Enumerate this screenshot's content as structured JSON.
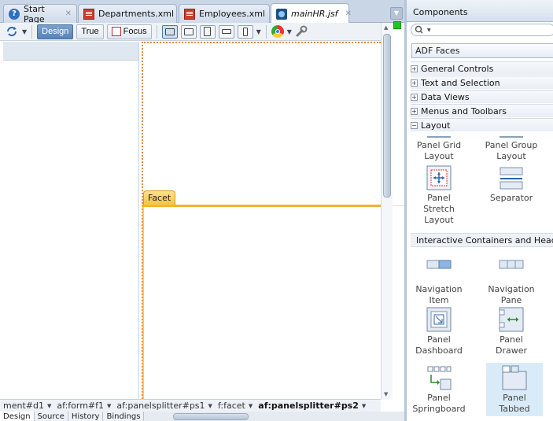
{
  "tabs": [
    {
      "label": "Start Page",
      "icon": "help-icon"
    },
    {
      "label": "Departments.xml",
      "icon": "xml-file-icon"
    },
    {
      "label": "Employees.xml",
      "icon": "xml-file-icon"
    },
    {
      "label": "mainHR.jsf",
      "icon": "jsf-file-icon",
      "active": true
    }
  ],
  "toolbar": {
    "design_label": "Design",
    "true_label": "True",
    "focus_label": "Focus"
  },
  "canvas": {
    "facet_label": "Facet"
  },
  "breadcrumb": [
    {
      "label": "ment#d1"
    },
    {
      "label": "af:form#f1"
    },
    {
      "label": "af:panelsplitter#ps1"
    },
    {
      "label": "f:facet"
    },
    {
      "label": "af:panelsplitter#ps2",
      "bold": true
    }
  ],
  "bottom_tabs": [
    "Design",
    "Source",
    "History",
    "Bindings"
  ],
  "palette": {
    "title": "Components",
    "search_placeholder": "",
    "library": "ADF Faces",
    "sections": [
      {
        "label": "General Controls",
        "expanded": false
      },
      {
        "label": "Text and Selection",
        "expanded": false
      },
      {
        "label": "Data Views",
        "expanded": false
      },
      {
        "label": "Menus and Toolbars",
        "expanded": false
      },
      {
        "label": "Layout",
        "expanded": true
      }
    ],
    "layout_items": [
      {
        "label": "Panel Grid Layout"
      },
      {
        "label": "Panel Group Layout"
      },
      {
        "label": "Panel Stretch Layout"
      },
      {
        "label": "Separator"
      }
    ],
    "interactive_header": "Interactive Containers and Headers",
    "interactive_items": [
      {
        "label": "Navigation Item"
      },
      {
        "label": "Navigation Pane"
      },
      {
        "label": "Panel Dashboard"
      },
      {
        "label": "Panel Drawer"
      },
      {
        "label": "Panel Springboard"
      },
      {
        "label": "Panel Tabbed",
        "selected": true
      }
    ]
  },
  "colors": {
    "accent": "#5a84b7",
    "facet": "#f2b232",
    "selection": "#d9ebf8"
  }
}
